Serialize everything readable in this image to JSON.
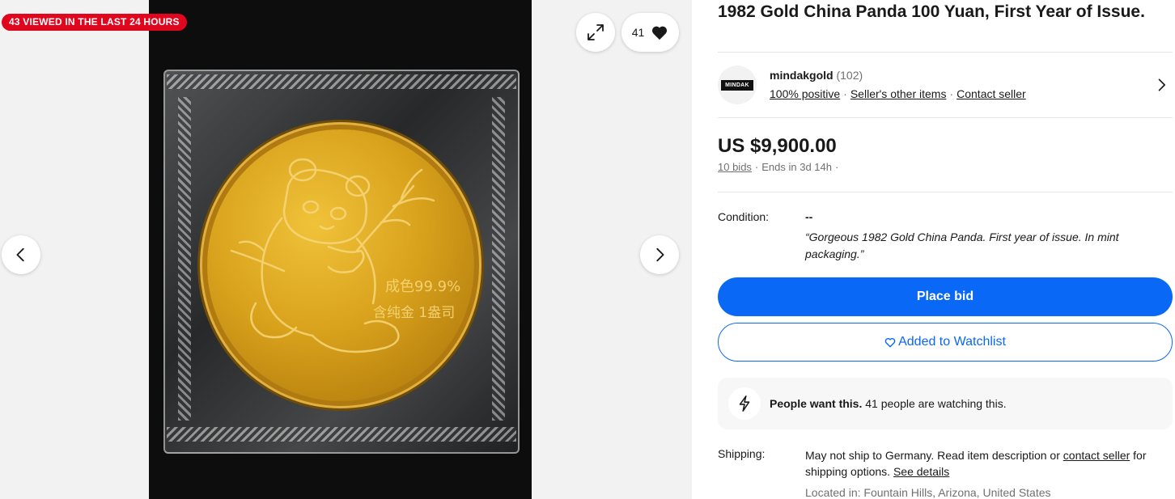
{
  "gallery": {
    "viewed_badge": "43 VIEWED IN THE LAST 24 HOURS",
    "watch_count": "41",
    "coin_text_1": "成色99.9%",
    "coin_text_2": "含纯金 1盎司",
    "icons": {
      "expand": "expand-icon",
      "heart": "heart-icon",
      "prev": "chevron-left-icon",
      "next": "chevron-right-icon"
    }
  },
  "listing": {
    "title": "1982 Gold China Panda 100 Yuan, First Year of Issue."
  },
  "seller": {
    "logo_text": "MINDAK",
    "name": "mindakgold",
    "score": "(102)",
    "feedback": "100% positive",
    "other_items": "Seller's other items",
    "contact": "Contact seller"
  },
  "pricing": {
    "price": "US $9,900.00",
    "bids": "10 bids",
    "ends": "Ends in 3d 14h",
    "trailing_dot": "·"
  },
  "condition": {
    "label": "Condition:",
    "value": "--",
    "quote": "“Gorgeous 1982 Gold China Panda. First year of issue. In mint packaging.”"
  },
  "actions": {
    "place_bid": "Place bid",
    "watchlist": "Added to Watchlist"
  },
  "signal": {
    "bold": "People want this.",
    "rest": " 41 people are watching this."
  },
  "shipping": {
    "label": "Shipping:",
    "text_1": "May not ship to Germany. Read item description or ",
    "contact_link": "contact seller",
    "text_2": " for shipping options. ",
    "details_link": "See details",
    "located": "Located in: Fountain Hills, Arizona, United States"
  },
  "colors": {
    "accent": "#0968f6",
    "badge": "#e0061e",
    "text": "#191919",
    "muted": "#707070"
  }
}
